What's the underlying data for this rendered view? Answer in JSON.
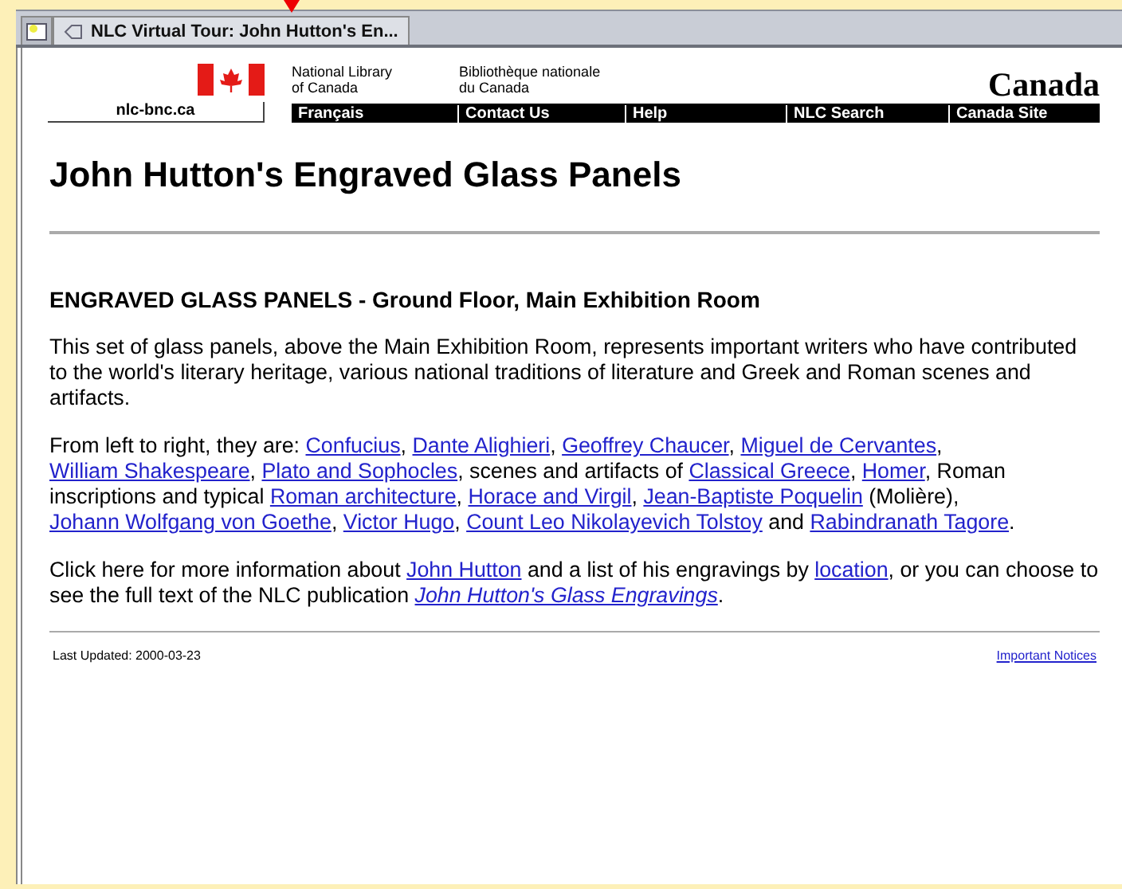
{
  "tabs": [
    {
      "kind": "icon",
      "selected": false
    },
    {
      "kind": "text",
      "label": "NLC Virtual Tour: John Hutton's En...",
      "selected": true
    }
  ],
  "header": {
    "library_en": [
      "National Library",
      "of Canada"
    ],
    "library_fr": [
      "Bibliothèque nationale",
      "du Canada"
    ],
    "site": "nlc-bnc.ca",
    "wordmark": "Canada",
    "nav": [
      "Français",
      "Contact Us",
      "Help",
      "NLC Search",
      "Canada Site"
    ]
  },
  "title": "John Hutton's Engraved Glass Panels",
  "heading": "ENGRAVED GLASS PANELS - Ground Floor, Main Exhibition Room",
  "paragraphs": [
    [
      {
        "kind": "text",
        "text": "This set of glass panels, above the Main Exhibition Room, represents important writers who have contributed to the world's literary heritage, various national traditions of literature and Greek and Roman scenes and artifacts."
      }
    ],
    [
      {
        "kind": "text",
        "text": "From left to right, they are: "
      },
      {
        "kind": "link",
        "text": "Confucius"
      },
      {
        "kind": "text",
        "text": ", "
      },
      {
        "kind": "link",
        "text": "Dante Alighieri"
      },
      {
        "kind": "text",
        "text": ", "
      },
      {
        "kind": "link",
        "text": "Geoffrey Chaucer"
      },
      {
        "kind": "text",
        "text": ", "
      },
      {
        "kind": "link",
        "text": "Miguel de Cervantes"
      },
      {
        "kind": "text",
        "text": ", "
      },
      {
        "kind": "link",
        "text": "William Shakespeare"
      },
      {
        "kind": "text",
        "text": ", "
      },
      {
        "kind": "link",
        "text": "Plato and Sophocles"
      },
      {
        "kind": "text",
        "text": ", scenes and artifacts of "
      },
      {
        "kind": "link",
        "text": "Classical Greece"
      },
      {
        "kind": "text",
        "text": ", "
      },
      {
        "kind": "link",
        "text": "Homer"
      },
      {
        "kind": "text",
        "text": ", Roman inscriptions and typical "
      },
      {
        "kind": "link",
        "text": "Roman architecture"
      },
      {
        "kind": "text",
        "text": ", "
      },
      {
        "kind": "link",
        "text": "Horace and Virgil"
      },
      {
        "kind": "text",
        "text": ", "
      },
      {
        "kind": "link",
        "text": "Jean-Baptiste Poquelin"
      },
      {
        "kind": "text",
        "text": " (Molière), "
      },
      {
        "kind": "link",
        "text": "Johann Wolfgang von Goethe"
      },
      {
        "kind": "text",
        "text": ", "
      },
      {
        "kind": "link",
        "text": "Victor Hugo"
      },
      {
        "kind": "text",
        "text": ", "
      },
      {
        "kind": "link",
        "text": "Count Leo Nikolayevich Tolstoy"
      },
      {
        "kind": "text",
        "text": " and "
      },
      {
        "kind": "link",
        "text": "Rabindranath Tagore"
      },
      {
        "kind": "text",
        "text": "."
      }
    ],
    [
      {
        "kind": "text",
        "text": "Click here for more information about "
      },
      {
        "kind": "link",
        "text": "John Hutton"
      },
      {
        "kind": "text",
        "text": " and a list of his engravings by "
      },
      {
        "kind": "link",
        "text": "location"
      },
      {
        "kind": "text",
        "text": ", or you can choose to see the full text of the NLC publication "
      },
      {
        "kind": "italic-link",
        "text": "John Hutton's Glass Engravings"
      },
      {
        "kind": "text",
        "text": "."
      }
    ]
  ],
  "footer": {
    "updated": "Last Updated: 2000-03-23",
    "notices": "Important Notices"
  }
}
